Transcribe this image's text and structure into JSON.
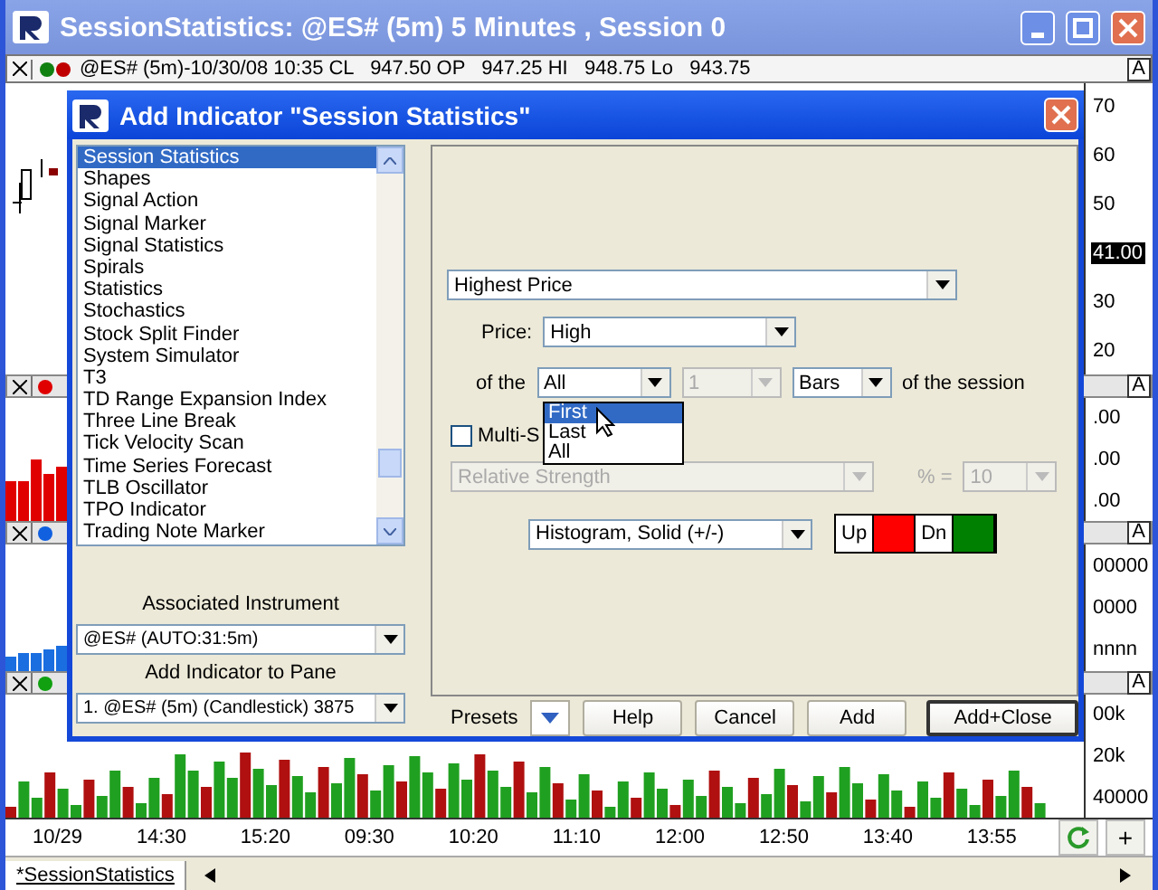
{
  "window": {
    "title": "SessionStatistics: @ES# (5m) 5 Minutes , Session 0"
  },
  "info_bar": {
    "text": "@ES# (5m)-10/30/08 10:35 CL   947.50 OP   947.25 HI   948.75 Lo   943.75",
    "badge": "A"
  },
  "panes": [
    {
      "kind": "candles",
      "axis": [
        {
          "label": "70",
          "highlighted": false
        },
        {
          "label": "60",
          "highlighted": false
        },
        {
          "label": "50",
          "highlighted": false
        },
        {
          "label": "41.00",
          "highlighted": true
        },
        {
          "label": "30",
          "highlighted": false
        },
        {
          "label": "20",
          "highlighted": false
        }
      ]
    },
    {
      "kind": "bars",
      "header": {
        "color": "#e00000",
        "badge": "A"
      },
      "axis": [
        {
          "label": ".00",
          "highlighted": false
        },
        {
          "label": ".00",
          "highlighted": false
        },
        {
          "label": ".00",
          "highlighted": false
        }
      ]
    },
    {
      "kind": "bars",
      "header": {
        "color": "#1060e0",
        "badge": "A"
      },
      "axis": [
        {
          "label": "00000",
          "highlighted": false
        },
        {
          "label": "0000",
          "highlighted": false
        },
        {
          "label": "nnnn",
          "highlighted": false
        }
      ]
    },
    {
      "kind": "volume",
      "header": {
        "color": "#10a010",
        "badge": "A"
      },
      "axis": [
        {
          "label": "00k",
          "highlighted": false
        },
        {
          "label": "20k",
          "highlighted": false
        },
        {
          "label": "40000",
          "highlighted": false
        }
      ]
    }
  ],
  "time_axis": [
    "10/29",
    "14:30",
    "15:20",
    "09:30",
    "10:20",
    "11:10",
    "12:00",
    "12:50",
    "13:40",
    "13:55"
  ],
  "zoom_button": "+",
  "sheet_tabs": [
    {
      "label": "*SessionStatistics",
      "selected": true
    }
  ],
  "dialog": {
    "title": "Add Indicator \"Session Statistics\"",
    "indicators": [
      {
        "label": "Session Statistics",
        "selected": true
      },
      {
        "label": "Shapes",
        "selected": false
      },
      {
        "label": "Signal Action",
        "selected": false
      },
      {
        "label": "Signal Marker",
        "selected": false
      },
      {
        "label": "Signal Statistics",
        "selected": false
      },
      {
        "label": "Spirals",
        "selected": false
      },
      {
        "label": "Statistics",
        "selected": false
      },
      {
        "label": "Stochastics",
        "selected": false
      },
      {
        "label": "Stock Split Finder",
        "selected": false
      },
      {
        "label": "System Simulator",
        "selected": false
      },
      {
        "label": "T3",
        "selected": false
      },
      {
        "label": "TD Range Expansion Index",
        "selected": false
      },
      {
        "label": "Three Line Break",
        "selected": false
      },
      {
        "label": "Tick Velocity Scan",
        "selected": false
      },
      {
        "label": "Time Series Forecast",
        "selected": false
      },
      {
        "label": "TLB Oscillator",
        "selected": false
      },
      {
        "label": "TPO Indicator",
        "selected": false
      },
      {
        "label": "Trading Note Marker",
        "selected": false
      }
    ],
    "associated_instrument": {
      "label": "Associated Instrument",
      "value": "@ES# (AUTO:31:5m)",
      "disabled": false
    },
    "pane": {
      "label": "Add Indicator to Pane",
      "value": "1. @ES# (5m) (Candlestick) 3875",
      "disabled": false
    },
    "statistic": {
      "value": "Highest Price",
      "disabled": false
    },
    "price": {
      "label": "Price:",
      "value": "High",
      "disabled": false
    },
    "of_the": {
      "label": "of the",
      "value": "All",
      "disabled": false
    },
    "count": {
      "value": "1",
      "disabled": true
    },
    "unit": {
      "value": "Bars",
      "disabled": false
    },
    "suffix": "of the session",
    "open_list": [
      {
        "label": "First",
        "selected": true
      },
      {
        "label": "Last",
        "selected": false
      },
      {
        "label": "All",
        "selected": false
      }
    ],
    "multi": {
      "label": "Multi-S",
      "checked": false
    },
    "multi_source": {
      "value": "Relative Strength",
      "disabled": true
    },
    "percent": {
      "label": "% =",
      "value": "10",
      "disabled": true
    },
    "style": {
      "value": "Histogram, Solid (+/-)",
      "disabled": false
    },
    "colors": [
      {
        "label": "Up",
        "color": "#ff0000"
      },
      {
        "label": "Dn",
        "color": "#008000"
      }
    ],
    "presets_label": "Presets",
    "buttons": [
      {
        "label": "Help",
        "default": false
      },
      {
        "label": "Cancel",
        "default": false
      },
      {
        "label": "Add",
        "default": false
      },
      {
        "label": "Add+Close",
        "default": true
      }
    ]
  }
}
